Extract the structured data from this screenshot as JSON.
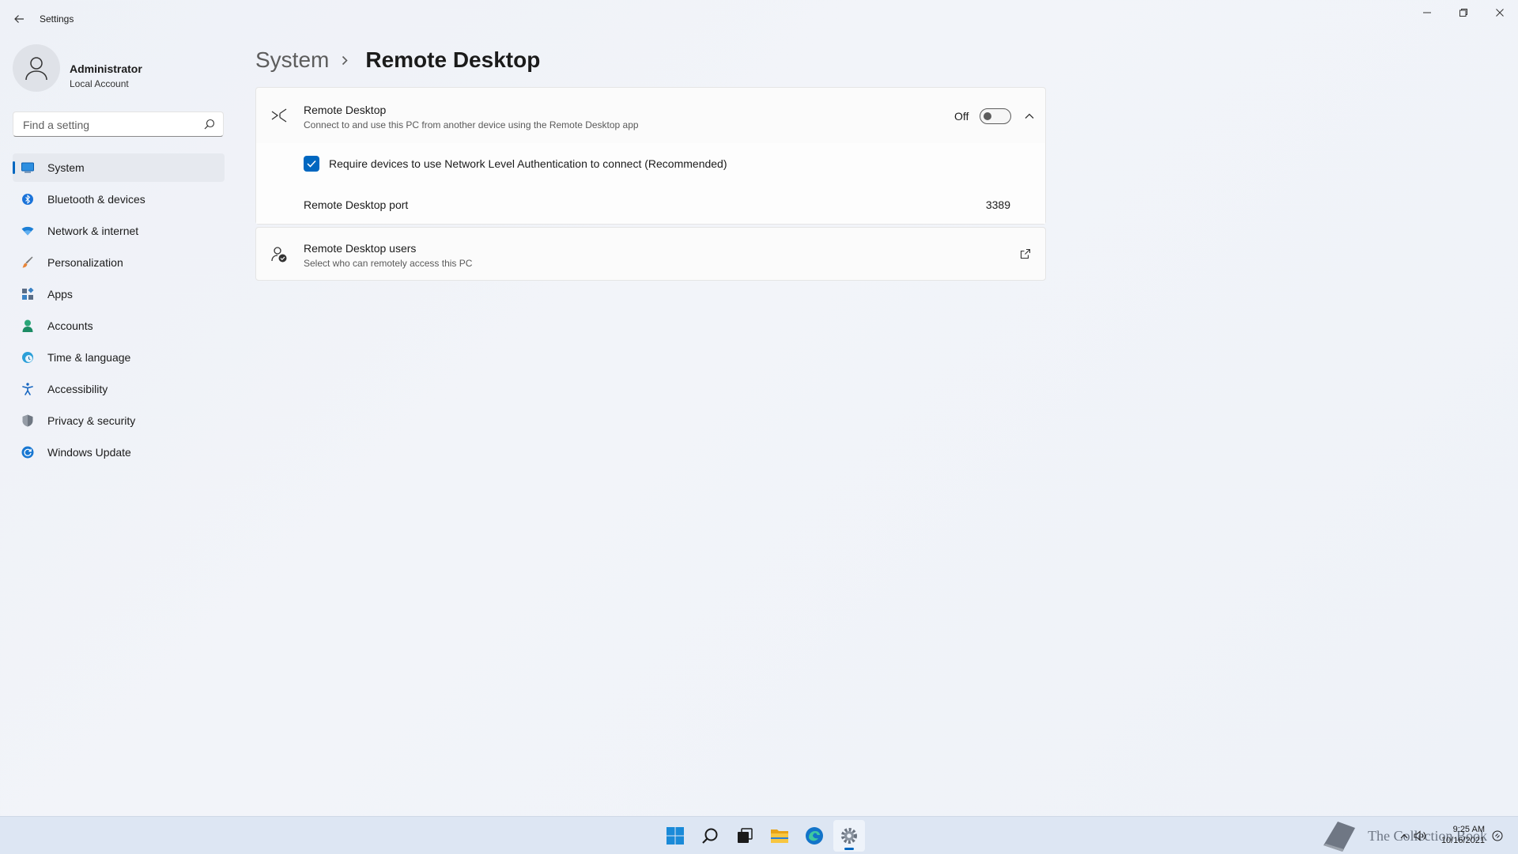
{
  "window": {
    "title": "Settings",
    "back_icon": "arrow-left-icon",
    "controls": [
      "minimize-icon",
      "restore-icon",
      "close-icon"
    ]
  },
  "user": {
    "name": "Administrator",
    "account_type": "Local Account"
  },
  "search": {
    "placeholder": "Find a setting"
  },
  "nav": {
    "items": [
      {
        "label": "System",
        "icon": "monitor-icon",
        "active": true
      },
      {
        "label": "Bluetooth & devices",
        "icon": "bluetooth-icon"
      },
      {
        "label": "Network & internet",
        "icon": "wifi-icon"
      },
      {
        "label": "Personalization",
        "icon": "brush-icon"
      },
      {
        "label": "Apps",
        "icon": "apps-icon"
      },
      {
        "label": "Accounts",
        "icon": "person-icon"
      },
      {
        "label": "Time & language",
        "icon": "globe-clock-icon"
      },
      {
        "label": "Accessibility",
        "icon": "accessibility-icon"
      },
      {
        "label": "Privacy & security",
        "icon": "shield-icon"
      },
      {
        "label": "Windows Update",
        "icon": "refresh-icon"
      }
    ]
  },
  "breadcrumb": {
    "parent": "System",
    "current": "Remote Desktop"
  },
  "remote_desktop": {
    "title": "Remote Desktop",
    "description": "Connect to and use this PC from another device using the Remote Desktop app",
    "toggle_state": "Off",
    "enabled": false,
    "nla_label": "Require devices to use Network Level Authentication to connect (Recommended)",
    "nla_checked": true,
    "port_label": "Remote Desktop port",
    "port_value": "3389"
  },
  "remote_users": {
    "title": "Remote Desktop users",
    "description": "Select who can remotely access this PC"
  },
  "taskbar": {
    "apps": [
      "windows-start-icon",
      "search-icon",
      "task-view-icon",
      "file-explorer-icon",
      "edge-icon",
      "settings-gear-icon"
    ],
    "watermark_text": "The Collection Book",
    "time": "9:25 AM",
    "date": "10/16/2021"
  },
  "colors": {
    "accent": "#0067c0",
    "background": "#f0f3f9",
    "card": "#fbfbfb",
    "taskbar": "#dde6f3"
  }
}
